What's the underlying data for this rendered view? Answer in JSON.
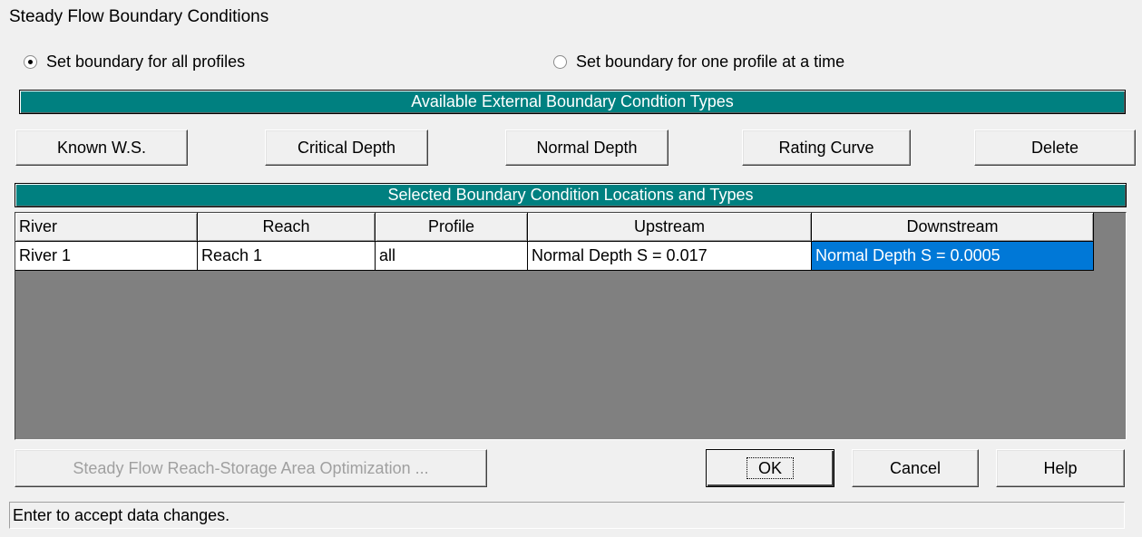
{
  "window": {
    "title": "Steady Flow Boundary Conditions"
  },
  "options": {
    "all_profiles_label": "Set boundary for all profiles",
    "one_profile_label": "Set boundary for one profile at a time"
  },
  "available": {
    "header": "Available External Boundary Condtion Types",
    "buttons": {
      "known_ws": "Known W.S.",
      "critical_depth": "Critical Depth",
      "normal_depth": "Normal Depth",
      "rating_curve": "Rating Curve",
      "delete": "Delete"
    }
  },
  "selected": {
    "header": "Selected Boundary Condition Locations and Types",
    "columns": [
      "River",
      "Reach",
      "Profile",
      "Upstream",
      "Downstream"
    ],
    "rows": [
      [
        "River 1",
        "Reach 1",
        "all",
        "Normal Depth S = 0.017",
        "Normal Depth S = 0.0005"
      ]
    ]
  },
  "footer": {
    "optimization_label": "Steady Flow Reach-Storage Area Optimization ...",
    "ok_label": "OK",
    "cancel_label": "Cancel",
    "help_label": "Help"
  },
  "status": {
    "message": "Enter to accept data changes."
  },
  "colors": {
    "accent": "#008080",
    "selection": "#0078d7",
    "grid_bg": "#808080"
  }
}
